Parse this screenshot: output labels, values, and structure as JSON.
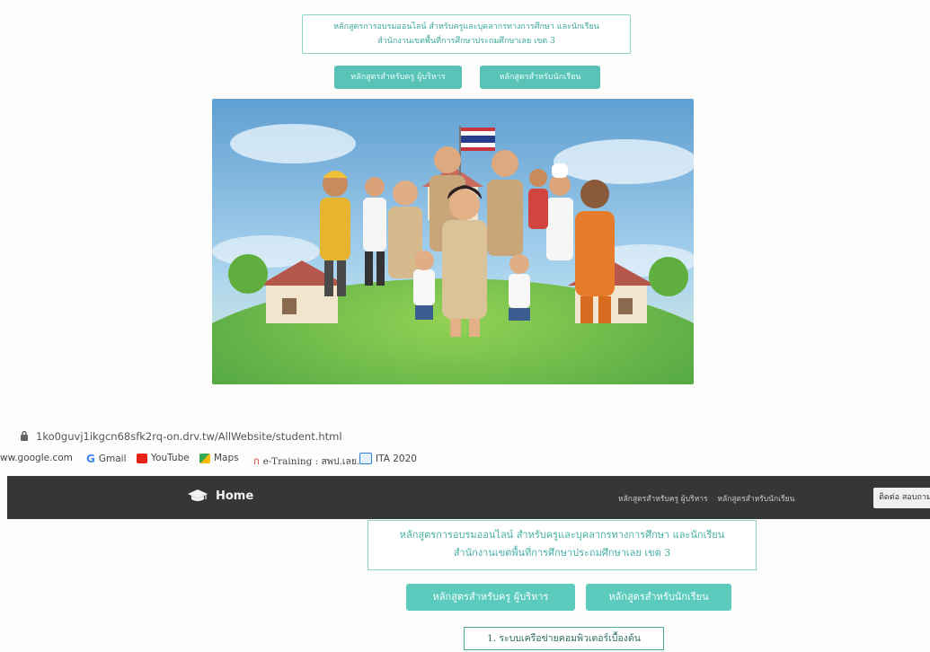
{
  "top_section": {
    "title_line1": "หลักสูตรการอบรมออนไลน์ สำหรับครูและบุคลากรทางการศึกษา และนักเรียน",
    "title_line2": "สำนักงานเขตพื้นที่การศึกษาประถมศึกษาเลย เขต 3",
    "teacher_button": "หลักสูตรสำหรับครู ผู้บริหาร",
    "student_button": "หลักสูตรสำหรับนักเรียน"
  },
  "browser": {
    "url": "1ko0guvj1ikgcn68sfk2rq-on.drv.tw/AllWebsite/student.html",
    "bookmarks": [
      {
        "label": "ww.google.com",
        "icon": "none"
      },
      {
        "label": "Gmail",
        "icon": "google-icon"
      },
      {
        "label": "YouTube",
        "icon": "youtube-icon"
      },
      {
        "label": "Maps",
        "icon": "maps-icon"
      },
      {
        "label": "e-Training : สพป.เลย...",
        "icon": "e-training-icon"
      },
      {
        "label": "ITA 2020",
        "icon": "ita-icon"
      }
    ]
  },
  "navbar": {
    "home_label": "Home",
    "link_teacher": "หลักสูตรสำหรับครู ผู้บริหาร",
    "link_student": "หลักสูตรสำหรับนักเรียน",
    "contact_label": "ติดต่อ สอบถาม"
  },
  "main": {
    "title_line1": "หลักสูตรการอบรมออนไลน์ สำหรับครูและบุคลากรทางการศึกษา และนักเรียน",
    "title_line2": "สำนักงานเขตพื้นที่การศึกษาประถมศึกษาเลย เขต 3",
    "teacher_button": "หลักสูตรสำหรับครู ผู้บริหาร",
    "student_button": "หลักสูตรสำหรับนักเรียน",
    "course_items": [
      "1. ระบบเครือข่ายคอมพิวเตอร์เบื้องต้น"
    ]
  },
  "colors": {
    "accent": "#5ccabd",
    "navbar": "#353638",
    "border": "#8fd3c9"
  }
}
